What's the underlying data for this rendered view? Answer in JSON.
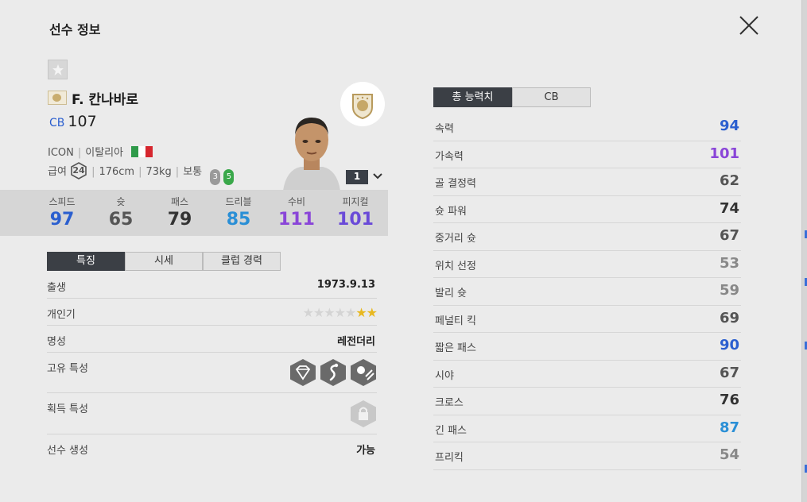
{
  "header": {
    "title": "선수 정보"
  },
  "player": {
    "name": "F. 칸나바로",
    "position": "CB",
    "ovr": "107",
    "season": "ICON",
    "nation": "이탈리아",
    "pay_label": "급여",
    "pay": "24",
    "height": "176cm",
    "weight": "73kg",
    "body": "보통",
    "weak_foot": "3",
    "strong_foot": "5",
    "upgrade_level": "1"
  },
  "summary_stats": [
    {
      "label": "스피드",
      "value": "97",
      "color": "#2b5fcf"
    },
    {
      "label": "슛",
      "value": "65",
      "color": "#555555"
    },
    {
      "label": "패스",
      "value": "79",
      "color": "#333333"
    },
    {
      "label": "드리블",
      "value": "85",
      "color": "#2a8fd6"
    },
    {
      "label": "수비",
      "value": "111",
      "color": "#8a45d8"
    },
    {
      "label": "피지컬",
      "value": "101",
      "color": "#6a4ad8"
    }
  ],
  "left_tabs": [
    "특징",
    "시세",
    "클럽 경력"
  ],
  "details": {
    "birth_label": "출생",
    "birth": "1973.9.13",
    "popularity_label": "개인기",
    "popularity_stars": 2,
    "popularity_max": 7,
    "reputation_label": "명성",
    "reputation": "레전더리",
    "traits_label": "고유 특성",
    "acquired_label": "획득 특성",
    "creation_label": "선수 생성",
    "creation": "가능"
  },
  "right_tabs": [
    "총 능력치",
    "CB"
  ],
  "attributes": [
    {
      "label": "속력",
      "value": "94",
      "color": "#2b5fcf"
    },
    {
      "label": "가속력",
      "value": "101",
      "color": "#8a45d8"
    },
    {
      "label": "골 결정력",
      "value": "62",
      "color": "#555555"
    },
    {
      "label": "슛 파워",
      "value": "74",
      "color": "#333333"
    },
    {
      "label": "중거리 슛",
      "value": "67",
      "color": "#555555"
    },
    {
      "label": "위치 선정",
      "value": "53",
      "color": "#888888"
    },
    {
      "label": "발리 슛",
      "value": "59",
      "color": "#888888"
    },
    {
      "label": "페널티 킥",
      "value": "69",
      "color": "#555555"
    },
    {
      "label": "짧은 패스",
      "value": "90",
      "color": "#2b5fcf"
    },
    {
      "label": "시야",
      "value": "67",
      "color": "#555555"
    },
    {
      "label": "크로스",
      "value": "76",
      "color": "#333333"
    },
    {
      "label": "긴 패스",
      "value": "87",
      "color": "#2a8fd6"
    },
    {
      "label": "프리킥",
      "value": "54",
      "color": "#888888"
    }
  ]
}
